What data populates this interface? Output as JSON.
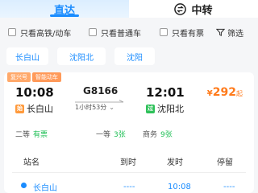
{
  "mode_tabs": {
    "direct_label": "直达",
    "transfer_label": "中转"
  },
  "filters": [
    {
      "label": "只看高铁/动车"
    },
    {
      "label": "只看普通车"
    },
    {
      "label": "只看有票"
    }
  ],
  "filter_button_label": "筛选",
  "station_chips": [
    "长白山",
    "沈阳北",
    "沈阳"
  ],
  "train": {
    "badges": [
      "复兴号",
      "智能动车"
    ],
    "train_no": "G8166",
    "dep_time": "10:08",
    "arr_time": "12:01",
    "duration": "1小时53分",
    "dep_station": "长白山",
    "arr_station": "沈阳北",
    "origin_tag": "始",
    "dest_tag": "过",
    "price_currency": "¥",
    "price": "292",
    "price_suffix": "起",
    "seats": [
      {
        "name": "二等",
        "status": "有票"
      },
      {
        "name": "一等",
        "status": "3张"
      },
      {
        "name": "商务",
        "status": "9张"
      }
    ]
  },
  "schedule": {
    "headers": [
      "站名",
      "到时",
      "发时",
      "停留"
    ],
    "rows": [
      {
        "station": "长白山",
        "arrive": "----",
        "depart": "10:08",
        "stop": "----"
      }
    ]
  },
  "colors": {
    "accent": "#1a8cff",
    "price": "#ff7a1a",
    "available": "#1fbf55"
  }
}
